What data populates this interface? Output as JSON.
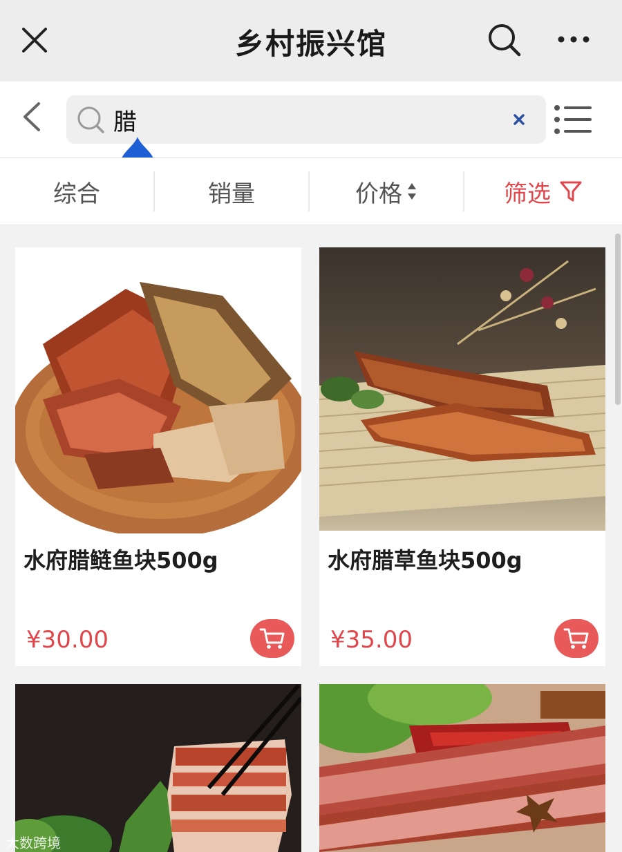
{
  "header": {
    "title": "乡村振兴馆",
    "close_icon": "close-icon",
    "search_icon": "search-icon",
    "more_icon": "more-icon"
  },
  "search": {
    "value": "腊",
    "back_icon": "back-icon",
    "clear_icon": "clear-icon",
    "list_view_icon": "list-view-icon"
  },
  "sort": {
    "items": [
      {
        "label": "综合"
      },
      {
        "label": "销量"
      },
      {
        "label": "价格"
      },
      {
        "label": "筛选"
      }
    ]
  },
  "products": [
    {
      "name": "水府腊鲢鱼块500g",
      "price": "¥30.00"
    },
    {
      "name": "水府腊草鱼块500g",
      "price": "¥35.00"
    },
    {
      "name": "",
      "price": ""
    },
    {
      "name": "",
      "price": ""
    }
  ],
  "watermark": "大数跨境",
  "colors": {
    "accent": "#e0474c",
    "cart_button": "#e85a5a",
    "title_bar": "#ededed",
    "cursor_handle": "#1f5fd4"
  }
}
